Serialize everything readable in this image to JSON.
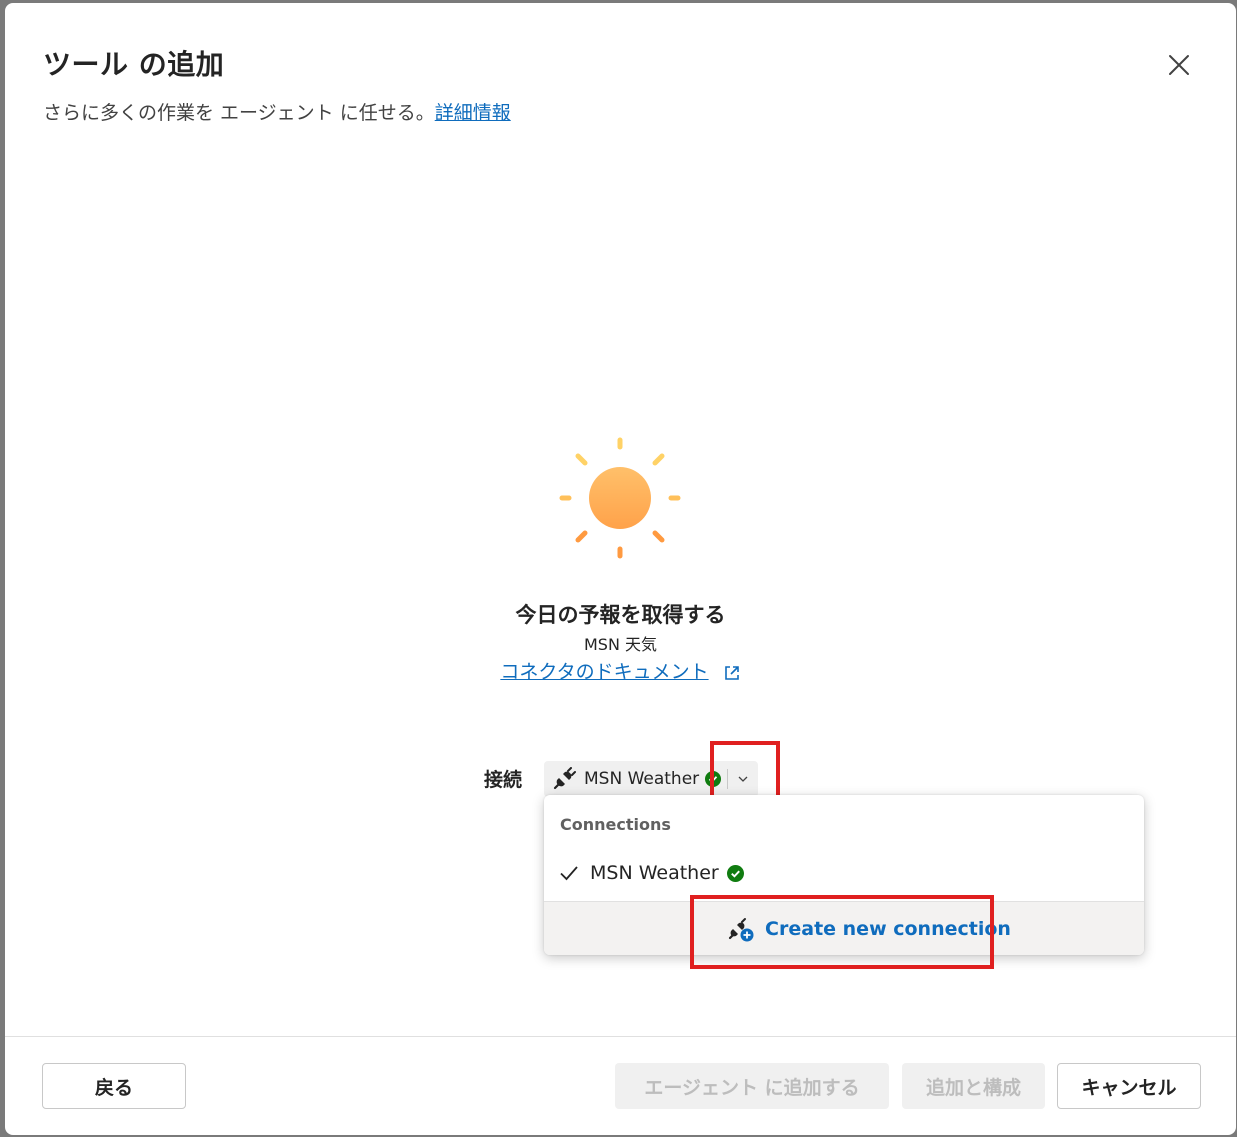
{
  "dialog": {
    "title": "ツール の追加",
    "subtitle": "さらに多くの作業を エージェント に任せる。",
    "learn_more": "詳細情報"
  },
  "tool": {
    "name": "今日の予報を取得する",
    "provider": "MSN 天気",
    "doc_link": "コネクタのドキュメント",
    "icon": "sun-icon"
  },
  "connection": {
    "label": "接続",
    "selected": "MSN Weather",
    "status": "connected"
  },
  "dropdown": {
    "header": "Connections",
    "items": [
      {
        "label": "MSN Weather",
        "selected": true,
        "status": "connected"
      }
    ],
    "create_label": "Create new connection"
  },
  "footer": {
    "back": "戻る",
    "add_to_agent": "エージェント に追加する",
    "add_and_configure": "追加と構成",
    "cancel": "キャンセル"
  },
  "colors": {
    "accent": "#0f6cbd",
    "success": "#107c10",
    "highlight": "#e02020",
    "sun": "#ffb347"
  }
}
